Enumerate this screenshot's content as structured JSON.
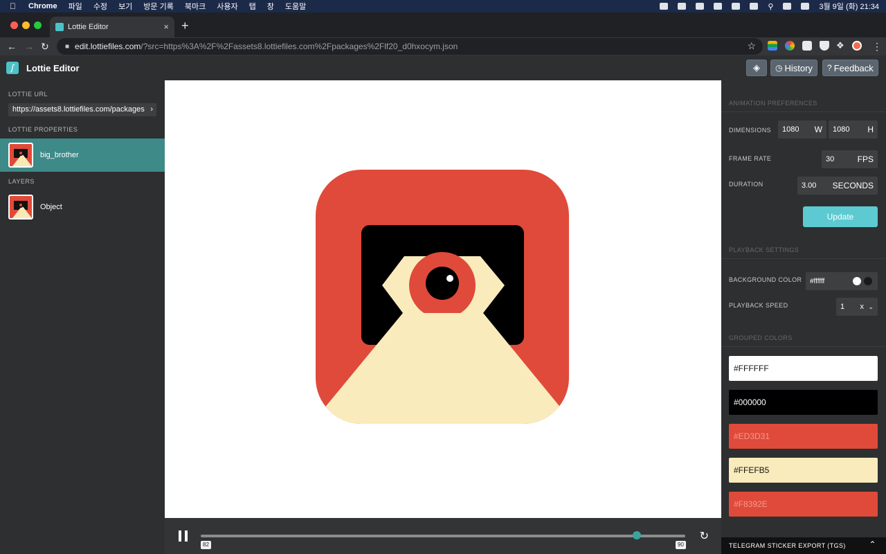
{
  "menubar": {
    "items": [
      "Chrome",
      "파일",
      "수정",
      "보기",
      "방문 기록",
      "북마크",
      "사용자",
      "탭",
      "창",
      "도움말"
    ],
    "datetime": "3월 9일 (화)  21:34"
  },
  "browser": {
    "tab_title": "Lottie Editor",
    "url_host": "edit.lottiefiles.com",
    "url_rest": "/?src=https%3A%2F%2Fassets8.lottiefiles.com%2Fpackages%2Flf20_d0hxocym.json"
  },
  "app": {
    "title": "Lottie Editor",
    "history_label": "History",
    "feedback_label": "Feedback"
  },
  "sidebar": {
    "lottie_url_heading": "LOTTIE URL",
    "lottie_url_value": "https://assets8.lottiefiles.com/packages",
    "properties_heading": "LOTTIE PROPERTIES",
    "property_name": "big_brother",
    "layers_heading": "LAYERS",
    "layers": [
      {
        "name": "Object"
      }
    ]
  },
  "player": {
    "start_frame": "82",
    "end_frame": "90",
    "progress": 0.9
  },
  "preferences": {
    "heading": "ANIMATION PREFERENCES",
    "dimensions_label": "DIMENSIONS",
    "width": "1080",
    "width_unit": "W",
    "height": "1080",
    "height_unit": "H",
    "frame_rate_label": "FRAME RATE",
    "frame_rate": "30",
    "frame_rate_unit": "FPS",
    "duration_label": "DURATION",
    "duration": "3.00",
    "duration_unit": "SECONDS",
    "update_label": "Update"
  },
  "playback": {
    "heading": "PLAYBACK SETTINGS",
    "bg_label": "BACKGROUND COLOR",
    "bg_value": "#ffffff",
    "speed_label": "PLAYBACK SPEED",
    "speed_value": "1",
    "speed_unit": "x"
  },
  "grouped_colors": {
    "heading": "GROUPED COLORS",
    "colors": [
      {
        "label": "#FFFFFF",
        "hex": "#ffffff",
        "text": "#111111"
      },
      {
        "label": "#000000",
        "hex": "#000000",
        "text": "#ffffff"
      },
      {
        "label": "#ED3D31",
        "hex": "#e04a3a",
        "text": "#f29a90"
      },
      {
        "label": "#FFEFB5",
        "hex": "#faebbc",
        "text": "#111111"
      },
      {
        "label": "#F8392E",
        "hex": "#e04a3a",
        "text": "#f29a90"
      }
    ]
  },
  "tgs": {
    "label": "TELEGRAM STICKER EXPORT (TGS)"
  },
  "colors": {
    "accent": "#4cc2c8",
    "selected_row": "#3d8a89",
    "icon_red": "#e04a3a",
    "icon_cream": "#faebbc"
  }
}
